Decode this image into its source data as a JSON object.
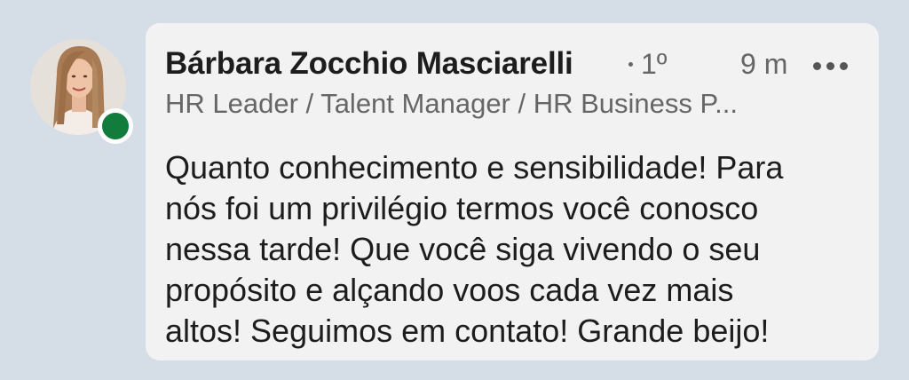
{
  "comment": {
    "author_name": "Bárbara Zocchio Masciarelli",
    "connection_degree": "1º",
    "time_ago": "9 m",
    "more_icon": "ellipsis-icon",
    "headline": "HR Leader / Talent Manager / HR Business P...",
    "text_lines": [
      "Quanto conhecimento e sensibilidade! Para",
      "nós foi um privilégio termos você conosco",
      "nessa tarde! Que você siga vivendo o seu",
      "propósito e alçando voos cada vez mais",
      "altos! Seguimos em contato! Grande beijo!"
    ],
    "presence_status_color": "#117c3c"
  }
}
